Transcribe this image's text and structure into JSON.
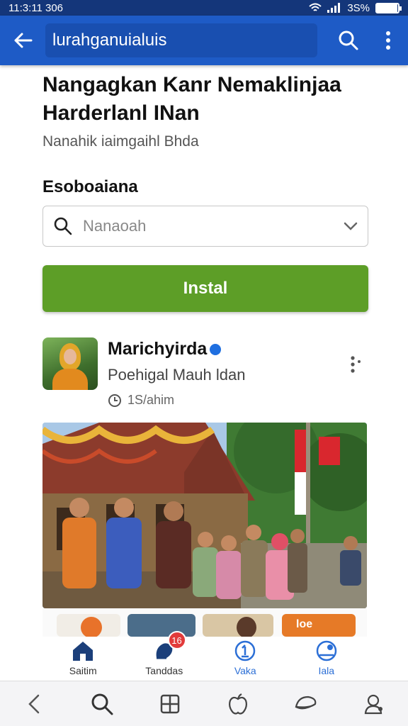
{
  "status_bar": {
    "time": "11:3:11 306",
    "battery_text": "3S%",
    "battery_level": 0.95
  },
  "app_bar": {
    "search_value": "lurahganuialuis"
  },
  "main": {
    "title": "Nangagkan Kanr Nemaklinjaa Harderlanl INan",
    "subtitle": "Nanahik iaimgaihl Bhda",
    "section_label": "Esoboaiana",
    "select_value": "Nanaoah",
    "install_label": "Instal"
  },
  "post": {
    "author": "Marichyirda",
    "author_subtitle": "Poehigal Mauh ldan",
    "time": "1S/ahim",
    "preview_tag": "loe"
  },
  "tabs": [
    {
      "label": "Saitim",
      "icon": "home-icon"
    },
    {
      "label": "Tanddas",
      "icon": "bell-icon",
      "badge": "16"
    },
    {
      "label": "Vaka",
      "icon": "info-icon"
    },
    {
      "label": "Iala",
      "icon": "profile-icon"
    }
  ],
  "colors": {
    "header": "#1e5bc6",
    "status": "#14367a",
    "install": "#5d9e27",
    "badge": "#e23b3b"
  },
  "nav_icons": [
    "back-icon",
    "search-icon",
    "grid-icon",
    "apple-icon",
    "cap-icon",
    "user-icon"
  ]
}
